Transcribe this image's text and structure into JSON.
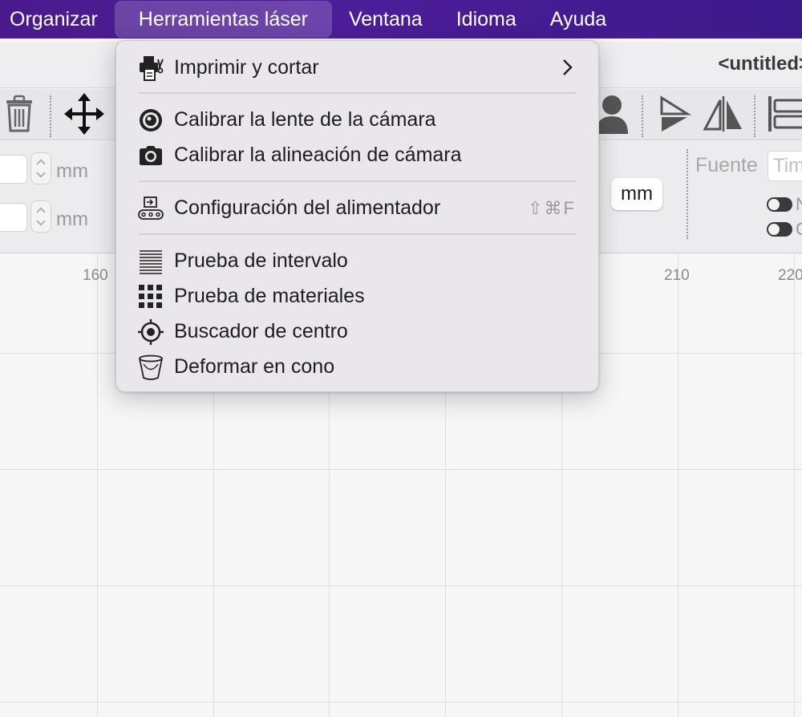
{
  "menubar": {
    "items": [
      {
        "label": "Organizar"
      },
      {
        "label": "Herramientas láser"
      },
      {
        "label": "Ventana"
      },
      {
        "label": "Idioma"
      },
      {
        "label": "Ayuda"
      }
    ]
  },
  "window": {
    "title": "<untitled>"
  },
  "props": {
    "unit_1": "mm",
    "unit_2": "mm",
    "unit_button": "mm",
    "font_label": "Fuente",
    "font_value": "Times",
    "toggle_1_label": "N",
    "toggle_2_label": "C"
  },
  "ruler": {
    "labels": [
      "160",
      "210",
      "220"
    ]
  },
  "dropdown": {
    "items": [
      {
        "label": "Imprimir y cortar",
        "icon": "printer-scissors-icon",
        "submenu": true
      },
      {
        "label": "Calibrar la lente de la cámara",
        "icon": "camera-lens-icon"
      },
      {
        "label": "Calibrar la alineación de cámara",
        "icon": "camera-icon"
      },
      {
        "label": "Configuración del alimentador",
        "icon": "conveyor-feeder-icon",
        "shortcut": "⇧⌘F"
      },
      {
        "label": "Prueba de intervalo",
        "icon": "interval-lines-icon"
      },
      {
        "label": "Prueba de materiales",
        "icon": "material-grid-icon"
      },
      {
        "label": "Buscador de centro",
        "icon": "crosshair-target-icon"
      },
      {
        "label": "Deformar en cono",
        "icon": "cone-cup-icon"
      }
    ]
  }
}
